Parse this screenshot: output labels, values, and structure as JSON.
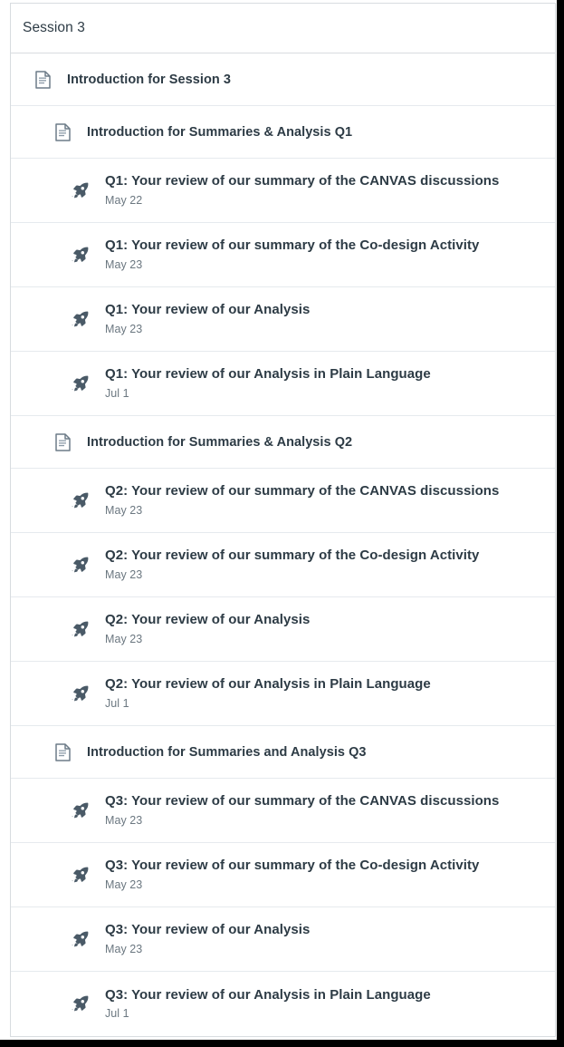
{
  "module": {
    "title": "Session 3",
    "icons": {
      "page": "document-page-icon",
      "quiz": "rocket-icon"
    },
    "colors": {
      "text_primary": "#2D3B45",
      "text_secondary": "#6B7780",
      "icon": "#556572",
      "border": "#D8DCE0",
      "row_divider": "#E6EAEE",
      "background": "#FFFFFF"
    },
    "rows": [
      {
        "kind": "subheader",
        "indent": 0,
        "icon": "document-page-icon",
        "title": "Introduction for Session 3"
      },
      {
        "kind": "subheader",
        "indent": 1,
        "icon": "document-page-icon",
        "title": "Introduction for Summaries & Analysis Q1"
      },
      {
        "kind": "item",
        "indent": 2,
        "icon": "rocket-icon",
        "title": "Q1: Your review of our summary of the CANVAS discussions",
        "date": "May 22"
      },
      {
        "kind": "item",
        "indent": 2,
        "icon": "rocket-icon",
        "title": "Q1: Your review of our summary of the Co-design Activity",
        "date": "May 23"
      },
      {
        "kind": "item",
        "indent": 2,
        "icon": "rocket-icon",
        "title": "Q1: Your review of our Analysis",
        "date": "May 23"
      },
      {
        "kind": "item",
        "indent": 2,
        "icon": "rocket-icon",
        "title": "Q1: Your review of our Analysis in Plain Language",
        "date": "Jul 1"
      },
      {
        "kind": "subheader",
        "indent": 1,
        "icon": "document-page-icon",
        "title": "Introduction for Summaries & Analysis Q2"
      },
      {
        "kind": "item",
        "indent": 2,
        "icon": "rocket-icon",
        "title": "Q2: Your review of our summary of the CANVAS discussions",
        "date": "May 23"
      },
      {
        "kind": "item",
        "indent": 2,
        "icon": "rocket-icon",
        "title": "Q2: Your review of our summary of the Co-design Activity",
        "date": "May 23"
      },
      {
        "kind": "item",
        "indent": 2,
        "icon": "rocket-icon",
        "title": "Q2: Your review of our Analysis",
        "date": "May 23"
      },
      {
        "kind": "item",
        "indent": 2,
        "icon": "rocket-icon",
        "title": "Q2: Your review of our Analysis in Plain Language",
        "date": "Jul 1"
      },
      {
        "kind": "subheader",
        "indent": 1,
        "icon": "document-page-icon",
        "title": "Introduction for Summaries and Analysis Q3"
      },
      {
        "kind": "item",
        "indent": 2,
        "icon": "rocket-icon",
        "title": "Q3: Your review of our summary of the CANVAS discussions",
        "date": "May 23"
      },
      {
        "kind": "item",
        "indent": 2,
        "icon": "rocket-icon",
        "title": "Q3: Your review of our summary of the Co-design Activity",
        "date": "May 23"
      },
      {
        "kind": "item",
        "indent": 2,
        "icon": "rocket-icon",
        "title": "Q3: Your review of our Analysis",
        "date": "May 23"
      },
      {
        "kind": "item",
        "indent": 2,
        "icon": "rocket-icon",
        "title": "Q3: Your review of our Analysis in Plain Language",
        "date": "Jul 1"
      }
    ]
  }
}
